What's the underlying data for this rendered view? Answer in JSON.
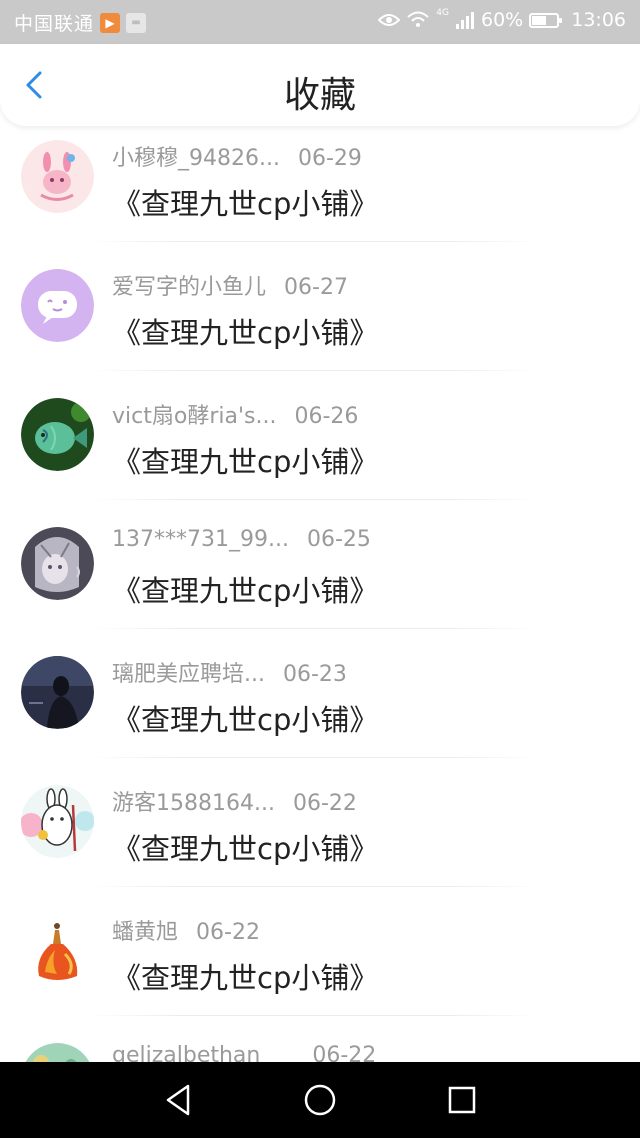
{
  "status_bar": {
    "carrier": "中国联通",
    "app_badge": "▶",
    "battery_percent": "60%",
    "battery_level": 0.6,
    "time": "13:06",
    "network": "4G"
  },
  "header": {
    "title": "收藏"
  },
  "list": {
    "items": [
      {
        "name": "小穆穆_94826...",
        "date": "06-29",
        "title": "《查理九世cp小铺》",
        "avatar": "pink-creature-avatar"
      },
      {
        "name": "爱写字的小鱼儿",
        "date": "06-27",
        "title": "《查理九世cp小铺》",
        "avatar": "purple-chat-avatar"
      },
      {
        "name": "vict扇o酵ria's...",
        "date": "06-26",
        "title": "《查理九世cp小铺》",
        "avatar": "fish-avatar"
      },
      {
        "name": "137***731_99...",
        "date": "06-25",
        "title": "《查理九世cp小铺》",
        "avatar": "anime-girl-avatar"
      },
      {
        "name": "璃肥美应聘培...",
        "date": "06-23",
        "title": "《查理九世cp小铺》",
        "avatar": "dark-photo-avatar"
      },
      {
        "name": "游客1588164...",
        "date": "06-22",
        "title": "《查理九世cp小铺》",
        "avatar": "rabbit-avatar"
      },
      {
        "name": "蟠黄旭",
        "date": "06-22",
        "title": "《查理九世cp小铺》",
        "avatar": "flame-dress-avatar"
      },
      {
        "name": "gelizalbethan",
        "date": "06-22",
        "title": "",
        "avatar": "green-avatar"
      }
    ]
  },
  "colors": {
    "accent": "#2e8be6",
    "status_bar_bg": "#c9c9c9",
    "name_text": "#9a9a9a",
    "title_text": "#222222"
  }
}
